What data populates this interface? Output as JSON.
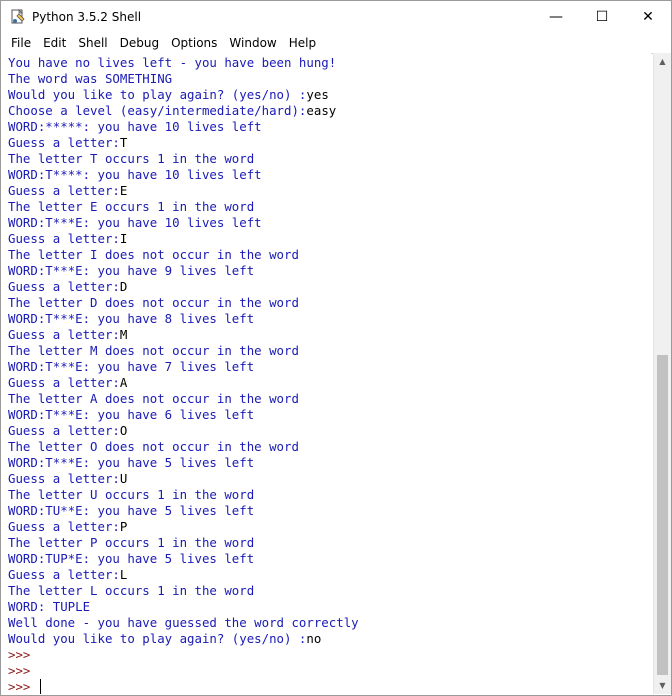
{
  "window": {
    "title": "Python 3.5.2 Shell",
    "controls": {
      "minimize": "—",
      "maximize": "☐",
      "close": "✕"
    }
  },
  "menu": [
    "File",
    "Edit",
    "Shell",
    "Debug",
    "Options",
    "Window",
    "Help"
  ],
  "shell": {
    "lines": [
      {
        "text": "You have no lives left - you have been hung!",
        "kind": "out"
      },
      {
        "text": "The word was SOMETHING",
        "kind": "out"
      },
      {
        "prefix": "Would you like to play again? (yes/no) :",
        "input": "yes",
        "kind": "mixed"
      },
      {
        "prefix": "Choose a level (easy/intermediate/hard):",
        "input": "easy",
        "kind": "mixed"
      },
      {
        "text": "WORD:*****: you have 10 lives left",
        "kind": "out"
      },
      {
        "prefix": "Guess a letter:",
        "input": "T",
        "kind": "mixed"
      },
      {
        "text": "The letter T occurs 1 in the word",
        "kind": "out"
      },
      {
        "text": "WORD:T****: you have 10 lives left",
        "kind": "out"
      },
      {
        "prefix": "Guess a letter:",
        "input": "E",
        "kind": "mixed"
      },
      {
        "text": "The letter E occurs 1 in the word",
        "kind": "out"
      },
      {
        "text": "WORD:T***E: you have 10 lives left",
        "kind": "out"
      },
      {
        "prefix": "Guess a letter:",
        "input": "I",
        "kind": "mixed"
      },
      {
        "text": "The letter I does not occur in the word",
        "kind": "out"
      },
      {
        "text": "WORD:T***E: you have 9 lives left",
        "kind": "out"
      },
      {
        "prefix": "Guess a letter:",
        "input": "D",
        "kind": "mixed"
      },
      {
        "text": "The letter D does not occur in the word",
        "kind": "out"
      },
      {
        "text": "WORD:T***E: you have 8 lives left",
        "kind": "out"
      },
      {
        "prefix": "Guess a letter:",
        "input": "M",
        "kind": "mixed"
      },
      {
        "text": "The letter M does not occur in the word",
        "kind": "out"
      },
      {
        "text": "WORD:T***E: you have 7 lives left",
        "kind": "out"
      },
      {
        "prefix": "Guess a letter:",
        "input": "A",
        "kind": "mixed"
      },
      {
        "text": "The letter A does not occur in the word",
        "kind": "out"
      },
      {
        "text": "WORD:T***E: you have 6 lives left",
        "kind": "out"
      },
      {
        "prefix": "Guess a letter:",
        "input": "O",
        "kind": "mixed"
      },
      {
        "text": "The letter O does not occur in the word",
        "kind": "out"
      },
      {
        "text": "WORD:T***E: you have 5 lives left",
        "kind": "out"
      },
      {
        "prefix": "Guess a letter:",
        "input": "U",
        "kind": "mixed"
      },
      {
        "text": "The letter U occurs 1 in the word",
        "kind": "out"
      },
      {
        "text": "WORD:TU**E: you have 5 lives left",
        "kind": "out"
      },
      {
        "prefix": "Guess a letter:",
        "input": "P",
        "kind": "mixed"
      },
      {
        "text": "The letter P occurs 1 in the word",
        "kind": "out"
      },
      {
        "text": "WORD:TUP*E: you have 5 lives left",
        "kind": "out"
      },
      {
        "prefix": "Guess a letter:",
        "input": "L",
        "kind": "mixed"
      },
      {
        "text": "The letter L occurs 1 in the word",
        "kind": "out"
      },
      {
        "text": "WORD: TUPLE",
        "kind": "out"
      },
      {
        "text": "Well done - you have guessed the word correctly",
        "kind": "out"
      },
      {
        "prefix": "Would you like to play again? (yes/no) :",
        "input": "no",
        "kind": "mixed"
      },
      {
        "text": ">>>",
        "kind": "prompt"
      },
      {
        "text": ">>>",
        "kind": "prompt"
      },
      {
        "text": ">>> ",
        "kind": "prompt",
        "cursor": true
      }
    ]
  },
  "colors": {
    "output": "#1a1ab5",
    "input": "#000000",
    "prompt": "#8b1a1a"
  }
}
